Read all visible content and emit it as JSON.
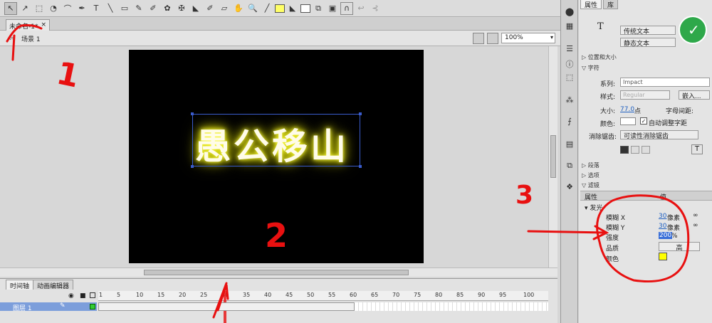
{
  "colors": {
    "accent_red": "#e81010",
    "glow": "#ffff40",
    "fill_yellow": "#ffff66",
    "stage_bg": "#000000"
  },
  "toolbar": {
    "tools": [
      "selection-tool",
      "subselection-tool",
      "free-transform-tool",
      "3d-rotation-tool",
      "lasso-tool",
      "pen-tool",
      "text-tool",
      "line-tool",
      "rectangle-tool",
      "pencil-tool",
      "brush-tool",
      "deco-tool",
      "bone-tool",
      "paint-bucket-tool",
      "eyedropper-tool",
      "eraser-tool",
      "hand-tool",
      "zoom-tool"
    ],
    "text_glyph": "T"
  },
  "document": {
    "tab_label": "未命名-1*",
    "tab_close": "×",
    "scene_label": "场景 1",
    "zoom": "100%"
  },
  "stage": {
    "text": "愚公移山"
  },
  "timeline": {
    "tabs": [
      "时间轴",
      "动画编辑器"
    ],
    "frame_numbers": [
      "1",
      "5",
      "10",
      "15",
      "20",
      "25",
      "30",
      "35",
      "40",
      "45",
      "50",
      "55",
      "60",
      "65",
      "70",
      "75",
      "80",
      "85",
      "90",
      "95",
      "100"
    ],
    "layer_name": "图层 1"
  },
  "properties": {
    "tabs": [
      "属性",
      "库"
    ],
    "text_type": "传统文本",
    "text_mode": "静态文本",
    "sections": {
      "position": "位置和大小",
      "character": "字符",
      "paragraph": "段落",
      "options": "选项",
      "filters": "滤镜"
    },
    "family_label": "系列:",
    "family_value": "Impact",
    "style_label": "样式:",
    "style_value": "Regular",
    "embed_button": "嵌入...",
    "size_label": "大小:",
    "size_value": "77.0",
    "size_unit": "点",
    "spacing_label": "字母间距:",
    "color_label": "颜色:",
    "auto_kern": "自动调整字距",
    "antialias_label": "消除锯齿:",
    "antialias_value": "可读性消除锯齿",
    "filter_col_prop": "属性",
    "filter_col_val": "值",
    "glow_label": "发光",
    "blur_x_label": "模糊 X",
    "blur_x_value": "30",
    "blur_y_label": "模糊 Y",
    "blur_y_value": "30",
    "unit_px": "像素",
    "strength_label": "强度",
    "strength_value": "200",
    "strength_unit": "%",
    "quality_label": "品质",
    "quality_value": "高",
    "color2_label": "颜色"
  },
  "annotations": {
    "n1": "1",
    "n2": "2",
    "n3": "3"
  }
}
